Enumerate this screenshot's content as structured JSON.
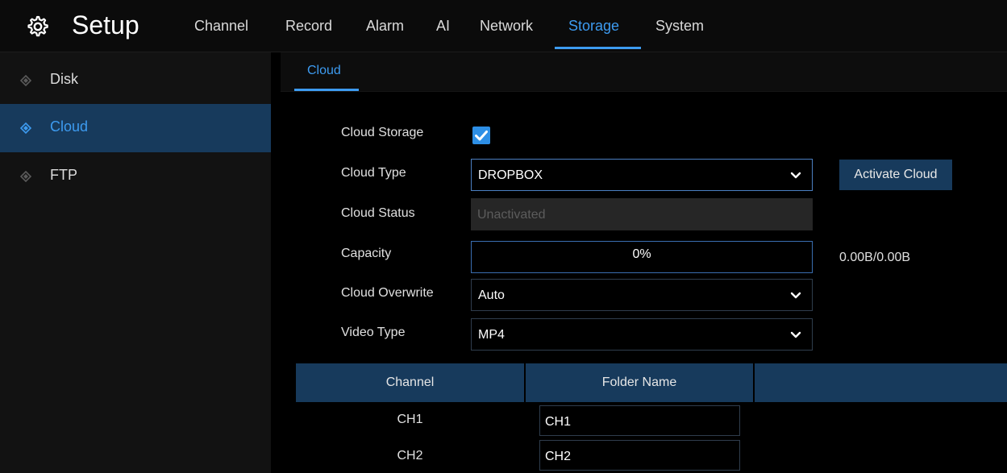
{
  "header": {
    "title": "Setup",
    "tabs": [
      {
        "label": "Channel"
      },
      {
        "label": "Record"
      },
      {
        "label": "Alarm"
      },
      {
        "label": "AI"
      },
      {
        "label": "Network"
      },
      {
        "label": "Storage",
        "active": true
      },
      {
        "label": "System"
      }
    ]
  },
  "sidebar": {
    "items": [
      {
        "label": "Disk"
      },
      {
        "label": "Cloud",
        "active": true
      },
      {
        "label": "FTP"
      }
    ]
  },
  "subtabs": [
    {
      "label": "Cloud"
    }
  ],
  "form": {
    "cloud_storage": {
      "label": "Cloud Storage",
      "checked": true
    },
    "cloud_type": {
      "label": "Cloud Type",
      "value": "DROPBOX"
    },
    "activate_button": "Activate Cloud",
    "cloud_status": {
      "label": "Cloud Status",
      "value": "Unactivated"
    },
    "capacity": {
      "label": "Capacity",
      "percent_text": "0%",
      "fraction": 0,
      "size": "0.00B/0.00B"
    },
    "cloud_overwrite": {
      "label": "Cloud Overwrite",
      "value": "Auto"
    },
    "video_type": {
      "label": "Video Type",
      "value": "MP4"
    }
  },
  "table": {
    "headers": [
      "Channel",
      "Folder Name",
      ""
    ],
    "rows": [
      {
        "channel": "CH1",
        "folder": "CH1"
      },
      {
        "channel": "CH2",
        "folder": "CH2"
      }
    ]
  },
  "colors": {
    "accent": "#3d9bf0",
    "selected_bg": "#173a5c",
    "checkbox": "#2d8fe6"
  },
  "icons": {
    "logo": "gear-icon",
    "sidebar": "diamond-icon",
    "dropdown": "chevron-down-icon",
    "check": "checkmark-icon"
  }
}
